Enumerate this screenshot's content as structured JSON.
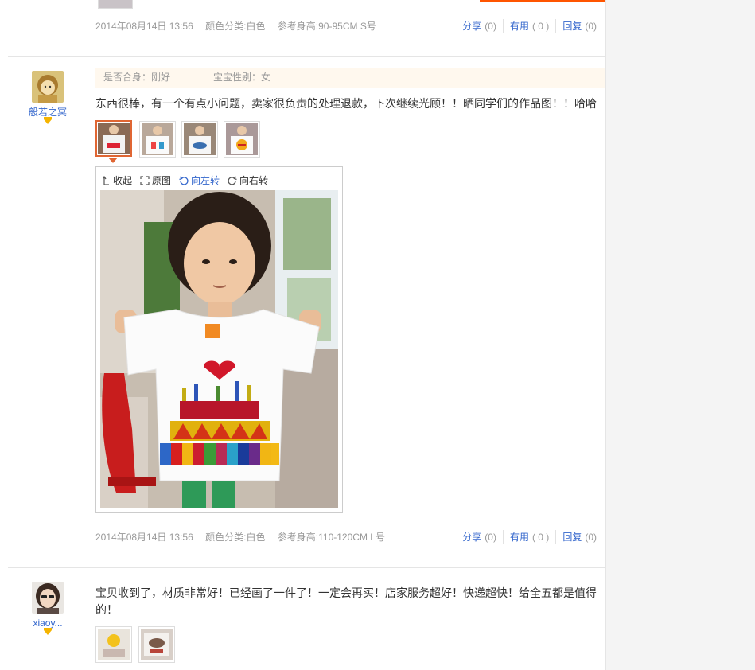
{
  "reviews": [
    {
      "meta": {
        "date": "2014年08月14日 13:56",
        "color": "颜色分类:白色",
        "height": "参考身高:90-95CM S号"
      },
      "actions": {
        "share": "分享",
        "share_count": "(0)",
        "useful": "有用",
        "useful_count": "( 0 )",
        "reply": "回复",
        "reply_count": "(0)"
      }
    },
    {
      "user": {
        "name": "般若之冥"
      },
      "attrs": {
        "fit": "是否合身：刚好",
        "gender": "宝宝性别：女"
      },
      "text": "东西很棒，有一个有点小问题，卖家很负责的处理退款，下次继续光顾！！晒同学们的作品图！！哈哈",
      "viewer": {
        "collapse": "收起",
        "original": "原图",
        "rotate_left": "向左转",
        "rotate_right": "向右转"
      },
      "meta": {
        "date": "2014年08月14日 13:56",
        "color": "颜色分类:白色",
        "height": "参考身高:110-120CM L号"
      },
      "actions": {
        "share": "分享",
        "share_count": "(0)",
        "useful": "有用",
        "useful_count": "( 0 )",
        "reply": "回复",
        "reply_count": "(0)"
      }
    },
    {
      "user": {
        "name": "xiaoy..."
      },
      "text": "宝贝收到了，材质非常好！已经画了一件了！一定会再买！店家服务超好！快递超快！给全五都是值得的！"
    }
  ],
  "colors": {
    "accent": "#ff5500",
    "link": "#3366cc",
    "muted": "#999999",
    "attr_bg": "#fff8ee"
  }
}
